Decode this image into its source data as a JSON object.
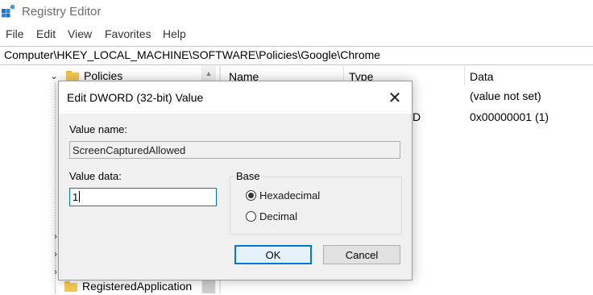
{
  "app": {
    "title": "Registry Editor",
    "icon": "registry-editor-icon"
  },
  "menu": {
    "items": [
      "File",
      "Edit",
      "View",
      "Favorites",
      "Help"
    ]
  },
  "address": {
    "path": "Computer\\HKEY_LOCAL_MACHINE\\SOFTWARE\\Policies\\Google\\Chrome"
  },
  "tree": {
    "items": [
      {
        "label": "Policies",
        "expanded": true
      },
      {
        "label": "RegisteredApplication",
        "expanded": false
      }
    ]
  },
  "list": {
    "headers": {
      "name": "Name",
      "type": "Type",
      "data": "Data"
    },
    "rows": [
      {
        "type_fragment": "",
        "data": "(value not set)"
      },
      {
        "type_fragment": "D",
        "data": "0x00000001 (1)"
      }
    ]
  },
  "dialog": {
    "title": "Edit DWORD (32-bit) Value",
    "value_name_label": "Value name:",
    "value_name": "ScreenCapturedAllowed",
    "value_data_label": "Value data:",
    "value_data": "1",
    "base": {
      "label": "Base",
      "options": [
        {
          "label": "Hexadecimal",
          "selected": true
        },
        {
          "label": "Decimal",
          "selected": false
        }
      ]
    },
    "ok_label": "OK",
    "cancel_label": "Cancel"
  },
  "colors": {
    "accent": "#0078d7",
    "dialog_bg": "#f0f0f0",
    "folder": "#f4c94f"
  }
}
